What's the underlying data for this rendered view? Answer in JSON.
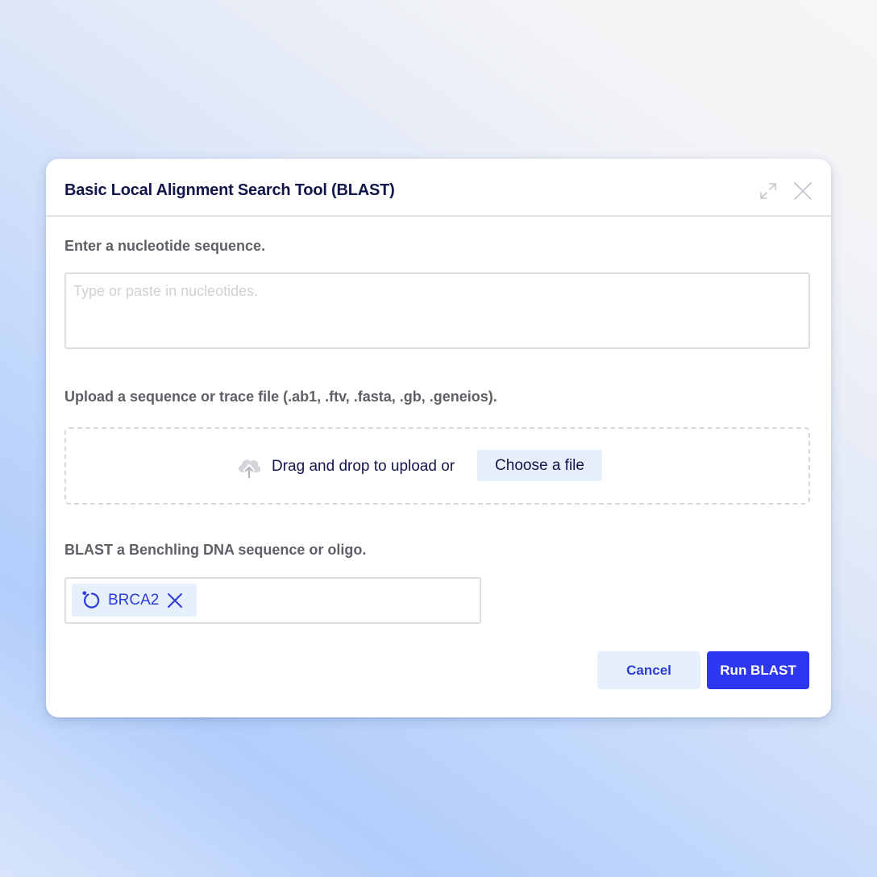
{
  "modal": {
    "title": "Basic Local Alignment Search Tool (BLAST)",
    "header_icons": [
      "expand-icon",
      "close-icon"
    ]
  },
  "sequence_entry": {
    "label": "Enter a nucleotide sequence.",
    "placeholder": "Type or paste in nucleotides.",
    "value": ""
  },
  "upload": {
    "label": "Upload a sequence or trace file (.ab1, .ftv, .fasta, .gb, .geneios).",
    "drag_text": "Drag and drop to upload or",
    "choose_label": "Choose a file",
    "icon": "cloud-upload-icon"
  },
  "benchling": {
    "label": "BLAST a Benchling DNA sequence or oligo.",
    "selected": [
      {
        "label": "BRCA2",
        "icon": "circular-plasmid-icon"
      }
    ]
  },
  "actions": {
    "cancel_label": "Cancel",
    "run_label": "Run BLAST"
  },
  "colors": {
    "primary": "#2e37f0",
    "primary_text": "#2d3bd9",
    "secondary_bg": "#e6f0fd",
    "title_text": "#10154a",
    "label_text": "#5f6066",
    "placeholder_text": "#d0d1d5"
  }
}
